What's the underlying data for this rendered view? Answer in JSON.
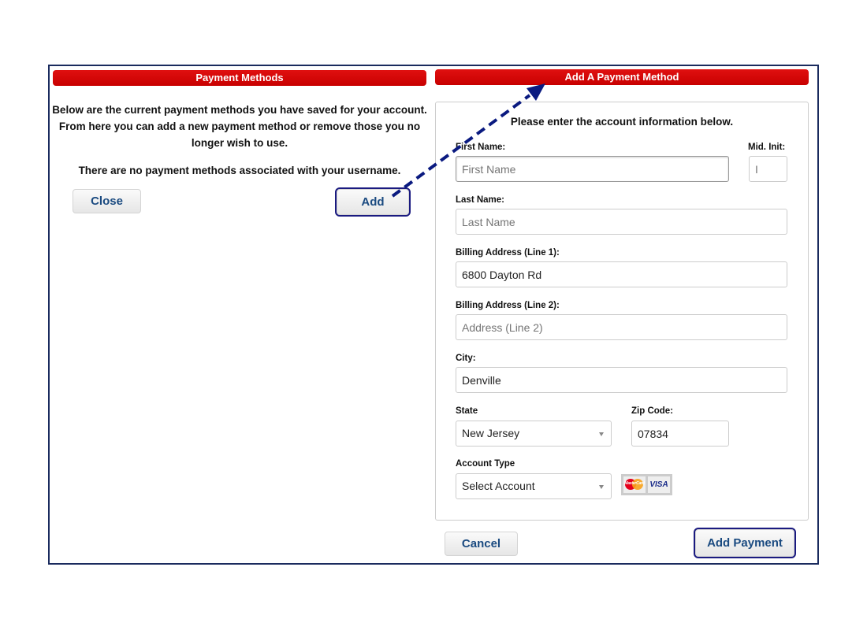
{
  "left_panel": {
    "title": "Payment Methods",
    "description_lines": [
      "Below are the current payment methods you have saved for your account.",
      "From here you can add a new payment method or remove those you no",
      "longer wish to use."
    ],
    "empty_message": "There are no payment methods associated with your username.",
    "close_label": "Close",
    "add_label": "Add"
  },
  "right_panel": {
    "title": "Add A Payment Method",
    "instructions": "Please enter the account information below.",
    "fields": {
      "first_name": {
        "label": "First Name:",
        "value": "",
        "placeholder": "First Name"
      },
      "mid_init": {
        "label": "Mid. Init:",
        "value": "",
        "placeholder": "I"
      },
      "last_name": {
        "label": "Last Name:",
        "value": "",
        "placeholder": "Last Name"
      },
      "address1": {
        "label": "Billing Address (Line 1):",
        "value": "6800 Dayton Rd",
        "placeholder": ""
      },
      "address2": {
        "label": "Billing Address (Line 2):",
        "value": "",
        "placeholder": "Address (Line 2)"
      },
      "city": {
        "label": "City:",
        "value": "Denville",
        "placeholder": ""
      },
      "state": {
        "label": "State",
        "value": "New Jersey"
      },
      "zip": {
        "label": "Zip Code:",
        "value": "07834",
        "placeholder": ""
      },
      "account_type": {
        "label": "Account Type",
        "value": "Select Account"
      }
    },
    "cards": [
      "MasterCard",
      "VISA"
    ],
    "cancel_label": "Cancel",
    "submit_label": "Add Payment"
  },
  "colors": {
    "header_red": "#d00000",
    "frame_navy": "#1a2b5e",
    "button_text": "#1a4a80",
    "annotation_arrow": "#0a1a80"
  }
}
